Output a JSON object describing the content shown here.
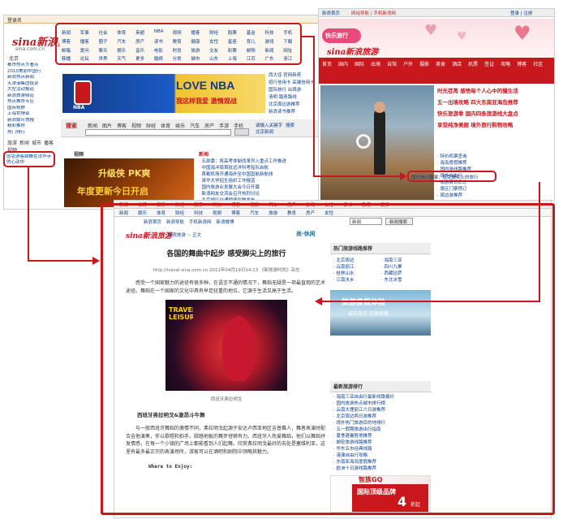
{
  "left_page": {
    "top_tab": "登录名",
    "logo_text": "sina新浪网",
    "logo_sub": "sina.com.cn",
    "city": "北京",
    "nav_rows": [
      [
        "新闻",
        "军事",
        "社会",
        "体育",
        "英超",
        "NBA",
        "视频",
        "播客",
        "财经",
        "股票",
        "基金",
        "科技",
        "手机"
      ],
      [
        "博客",
        "播客",
        "圈子",
        "汽车",
        "房产",
        "读书",
        "教育",
        "健康",
        "女性",
        "星座",
        "育儿",
        "游戏",
        "下载"
      ],
      [
        "邮箱",
        "爱问",
        "聊天",
        "娱乐",
        "音乐",
        "电影",
        "时尚",
        "旅游",
        "交友",
        "彩票",
        "邮购",
        "新闻",
        "网址"
      ],
      [
        "韩播",
        "论坛",
        "世界",
        "天气",
        "更多",
        "婚嫁",
        "分类",
        "城市",
        "山东",
        "上海",
        "江苏",
        "广东",
        "浙江"
      ]
    ],
    "left_links": [
      "都市热点大看点",
      "2010美丽中国行",
      "新浪热点新闻",
      "天津港集团投资",
      "大型活动报道",
      "新浪旅游频道",
      "热点推荐专区",
      "国际视野",
      "上海世博会",
      "新浪娱乐快报",
      "精彩推荐",
      "热门排行"
    ],
    "nba_banner": "LOVE NBA",
    "nba_sub": "我这样我爱 激情观战",
    "nba_logo": "NBA",
    "search_label": "搜索",
    "mid_links": [
      "西大佳 官网新奇",
      "招行信用卡 高端信用卡",
      "国际旅行 出境游",
      "清明 踏青路线",
      "北京周边游推荐",
      "新浪读书推荐"
    ],
    "tabs": [
      "新闻",
      "图片",
      "博客",
      "视频",
      "财经",
      "体育",
      "娱乐",
      "汽车",
      "房产",
      "手游",
      "手机"
    ],
    "hot_links": [
      "请输入关键字",
      "搜索",
      "北京新闻"
    ],
    "left_sidebar": [
      "旅游",
      "新闻",
      "城市",
      "播客",
      "视频"
    ],
    "highlight_link": "感受游客跳舞在法华寺的心动中",
    "game_banner": "升级侠 PK爽",
    "game_sub": "年度更新今日开启",
    "section_title": "视频",
    "section_title2": "新闻",
    "news_items": [
      "五部委：将高考体制改革列入重点工作推进",
      "中国海洋局首批远洋科考船队启航",
      "首都机场开通海外至中国直航新航线",
      "清华大学招生组织工作报道",
      "国内旅游业发展大会今日开幕",
      "新浪网友交流会召开热烈讨论",
      "北京城区交通拥堵指数发布",
      "全国两会热点话题新闻汇总"
    ]
  },
  "right_page": {
    "topbar_left": "新浪首页",
    "topbar_mid": "网站导航 | 手机新浪网",
    "topbar_right": "登录 | 注册",
    "logo": "sina新浪旅游",
    "heart_banner": "快乐旅行",
    "nav_items": [
      "首页",
      "国内",
      "国际",
      "出境",
      "自驾",
      "户外",
      "摄影",
      "美食",
      "酒店",
      "机票",
      "签证",
      "攻略",
      "博客",
      "社区"
    ],
    "headline_1": "时光荏苒 感悟每个人心中的慢生活",
    "headline_2": "五一出境攻略 四大东南亚海岛推荐",
    "headline_3": "快乐旅游季 国内四条旅游线大盘点",
    "headline_4": "享受纯净美丽 境外旅行购物攻略",
    "highlight_text": "国外旅行趣事：感受脚尖上的旅行",
    "side_list": [
      "特价机票查询",
      "海岛度假推荐",
      "国内游线路推荐",
      "境外自由行",
      "旅游资讯汇总",
      "景区门票预订",
      "周边游推荐"
    ]
  },
  "bottom_page": {
    "nav_top": [
      "新闻",
      "体育",
      "娱乐",
      "财经",
      "股票",
      "科技",
      "博客",
      "视频",
      "汽车",
      "房产",
      "游戏",
      "女性",
      "读书",
      "教育",
      "更多"
    ],
    "nav_bottom": [
      "新闻",
      "娱乐",
      "体育",
      "财经",
      "科技",
      "视频",
      "博客",
      "汽车",
      "旅游",
      "教育",
      "房产",
      "女性"
    ],
    "top_links": [
      "新浪首页",
      "新浪导航",
      "手机新浪网",
      "新浪微博"
    ],
    "search_placeholder": "新闻",
    "search_button": "新闻搜索",
    "logo": "sina新浪旅游",
    "breadcrumb": [
      "新浪旅游",
      "正文"
    ],
    "brand_badge": "尚·休闲",
    "title": "各国的舞曲中起步 感受脚尖上的旅行",
    "meta": "http://travel.sina.com.cn 2011年04月19日14:13 《新旅游时尚》杂志",
    "paragraph_1": "感受一个国家魅力的途径有很多种，在语言不通的情况下，舞蹈无疑是一项最直观的艺术途径。舞蹈在一个国家的文化中具有举足轻重的地位，它源于生活又高于生活。",
    "image_caption": "西班牙弗拉明戈",
    "image_text_overlay": "TRAVEL LEISURE",
    "subtitle": "西班牙弗拉明戈&激昂斗牛舞",
    "paragraph_2": "与一般西班牙舞蹈的激情不同，弗拉明戈起源于安达卢西亚地区吉普赛人，舞者表演时配合吉他演奏，伴以歌唱和拍手，踩踏地板的舞步铿锵有力。西班牙人热爱舞蹈，他们以舞蹈抒发情感，在每一个小镇的广场上都能看到人们起舞。欣赏弗拉明戈最好的去处是塞维利亚，这里有最多最正宗的表演场所，游客可以在酒吧和剧院中领略其魅力。",
    "where_label": "Where to Enjoy:",
    "sidebar_title": "热门旅游线路推荐",
    "sidebar_links": [
      "北京周边",
      "海南三亚",
      "云南丽江",
      "四川九寨",
      "桂林山水",
      "西藏拉萨",
      "江南水乡",
      "东北冰雪"
    ],
    "ad_title": "旅游度假体验",
    "ad_sub": "城市风光 尽享假期",
    "section2_title": "最新旅游排行",
    "section2_links": [
      "海南三亚自由行最新线路报价",
      "国内旅游热点城市排行榜",
      "云南大理丽江六日游推荐",
      "北京周边两日游推荐",
      "境外热门旅游目的地排行",
      "五一假期旅游出行指南",
      "夏季避暑胜地推荐",
      "邮轮旅游线路推荐",
      "华东五市经典线路",
      "港澳自由行攻略",
      "东南亚海岛度假推荐",
      "欧洲十日游线路推荐"
    ],
    "bottom_ad_title": "智族GQ",
    "bottom_ad_line": "国际顶级品牌",
    "bottom_ad_discount": "4",
    "bottom_ad_suffix": "折起"
  },
  "colors": {
    "accent": "#c8171d",
    "link": "#0b3e8c",
    "nba_blue": "#123c8a",
    "gold": "#f1c232"
  }
}
